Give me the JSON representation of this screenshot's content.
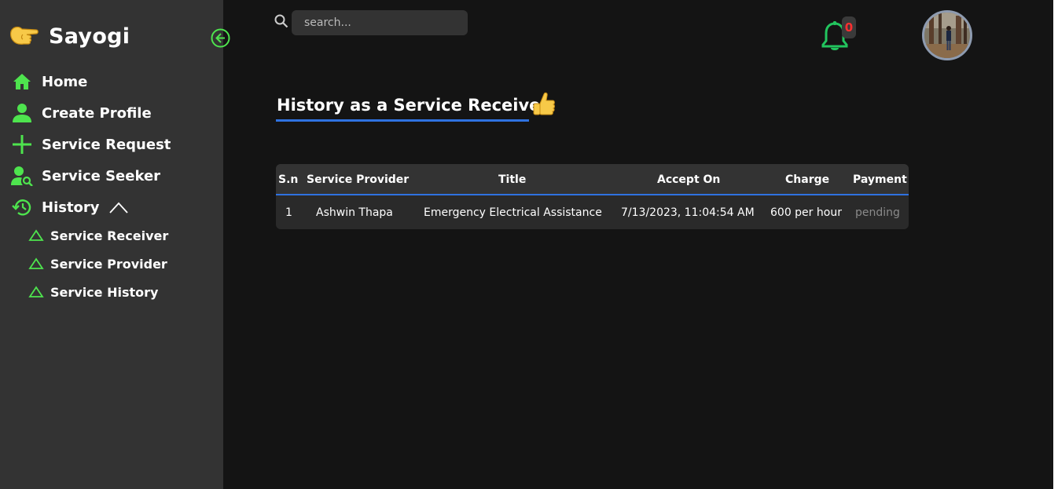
{
  "sidebar": {
    "brand": "Sayogi",
    "items": [
      {
        "label": "Home",
        "icon": "home-icon"
      },
      {
        "label": "Create Profile",
        "icon": "person-icon"
      },
      {
        "label": "Service Request",
        "icon": "plus-icon"
      },
      {
        "label": "Service Seeker",
        "icon": "person-search-icon"
      },
      {
        "label": "History",
        "icon": "history-icon"
      }
    ],
    "history_subitems": [
      {
        "label": "Service Receiver"
      },
      {
        "label": "Service Provider"
      },
      {
        "label": "Service History"
      }
    ]
  },
  "topbar": {
    "search_placeholder": "search...",
    "notification_count": "0"
  },
  "main": {
    "title": "History as a Service Receiver",
    "table": {
      "columns": [
        "S.n",
        "Service Provider",
        "Title",
        "Accept On",
        "Charge",
        "Payment"
      ],
      "rows": [
        [
          "1",
          "Ashwin Thapa",
          "Emergency Electrical Assistance",
          "7/13/2023, 11:04:54 AM",
          "600 per hour",
          "pending"
        ]
      ]
    }
  },
  "colors": {
    "accent_green": "#4ee44e",
    "accent_blue": "#2f72e0",
    "sidebar_bg": "#333333",
    "page_bg": "#141414",
    "badge_red": "#ff3030"
  }
}
